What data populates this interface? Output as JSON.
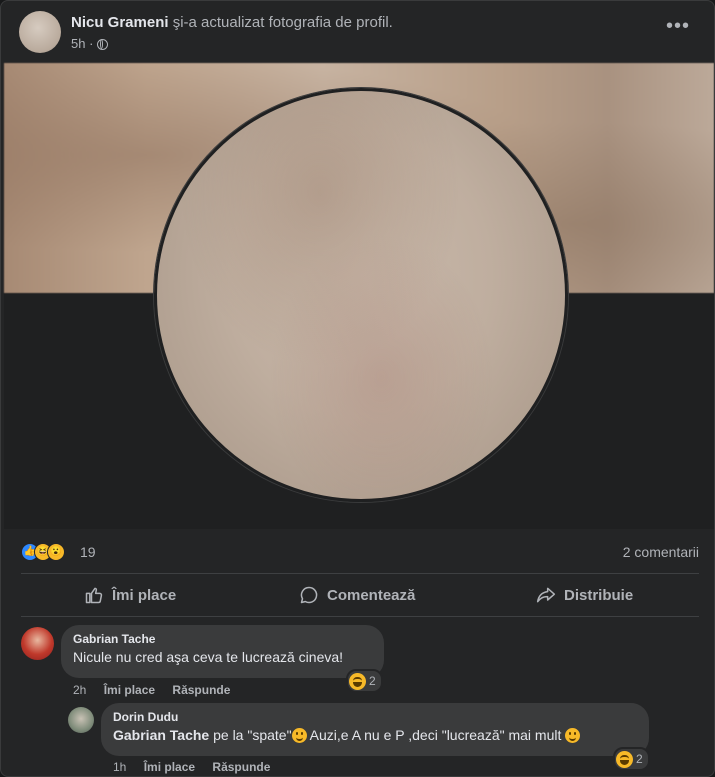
{
  "post": {
    "author": "Nicu Grameni",
    "action": "şi-a actualizat fotografia de profil.",
    "time": "5h",
    "privacy_icon": "globe-icon",
    "menu_icon": "more-icon"
  },
  "stats": {
    "reactions": [
      "like",
      "haha",
      "wow"
    ],
    "reaction_count": "19",
    "comment_count": "2 comentarii"
  },
  "actions": {
    "like": "Îmi place",
    "comment": "Comentează",
    "share": "Distribuie"
  },
  "comments": [
    {
      "author": "Gabrian Tache",
      "text": "Nicule nu cred aşa ceva te lucrează cineva!",
      "time": "2h",
      "like": "Îmi place",
      "reply": "Răspunde",
      "reaction_count": "2"
    },
    {
      "author": "Dorin Dudu",
      "mention": "Gabrian Tache",
      "text_a": " pe la \"spate\"",
      "text_b": " Auzi,e A nu e P ,deci \"lucrează\" mai mult ",
      "time": "1h",
      "like": "Îmi place",
      "reply": "Răspunde",
      "reaction_count": "2"
    }
  ],
  "colors": {
    "background": "#242526",
    "bubble": "#3a3b3c",
    "like_blue": "#2d88ff",
    "emoji_yellow": "#f7b928"
  }
}
